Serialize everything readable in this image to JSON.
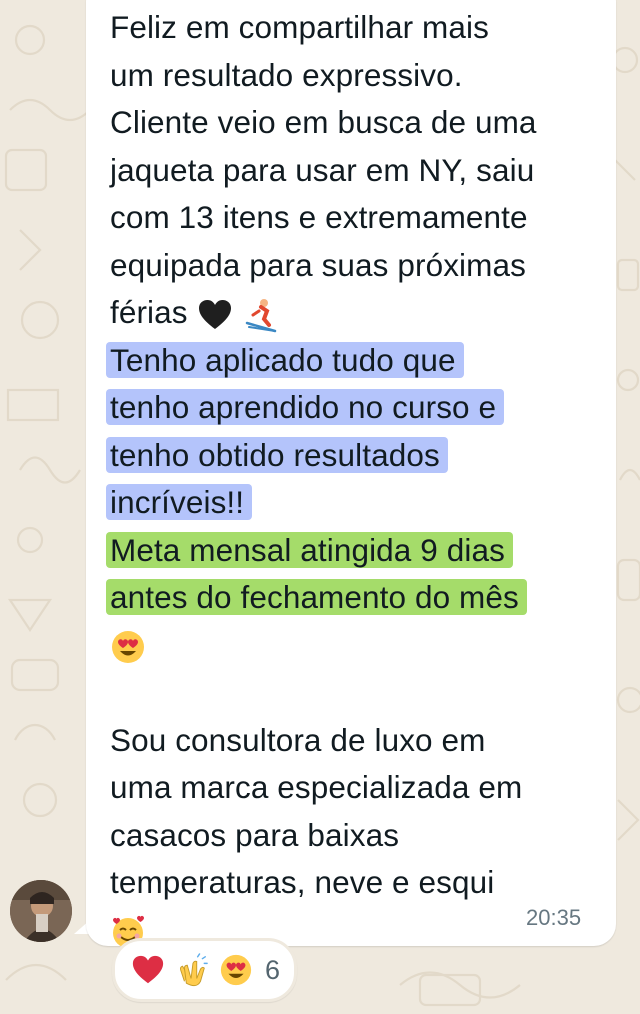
{
  "message": {
    "paragraph1": [
      "Feliz em compartilhar mais",
      "um resultado expressivo.",
      "Cliente veio em busca de uma",
      "jaqueta para usar em NY, saiu",
      "com 13 itens e extremamente",
      "equipada para suas próximas",
      "férias"
    ],
    "paragraph1_emojis": [
      "black-heart-emoji",
      "skier-emoji"
    ],
    "blue_highlight": [
      "Tenho aplicado tudo que",
      "tenho aprendido no curso e",
      "tenho obtido resultados",
      "incríveis!!"
    ],
    "green_highlight": [
      "Meta mensal atingida 9 dias",
      "antes do fechamento do mês"
    ],
    "green_emoji": "heart-eyes-emoji",
    "paragraph2": [
      "Sou consultora de luxo em",
      "uma marca especializada em",
      "casacos para baixas",
      "temperaturas, neve e esqui"
    ],
    "paragraph2_emoji": "smiling-face-with-hearts-emoji",
    "timestamp": "20:35"
  },
  "reactions": {
    "emojis": [
      "red-heart-emoji",
      "clapping-hands-emoji",
      "heart-eyes-emoji"
    ],
    "count": "6"
  },
  "colors": {
    "bubble": "#ffffff",
    "wallpaper": "#efe9de",
    "highlight_blue": "#b4c4fb",
    "highlight_green": "#a5dc6a",
    "text": "#111b21",
    "timestamp": "#667781"
  }
}
